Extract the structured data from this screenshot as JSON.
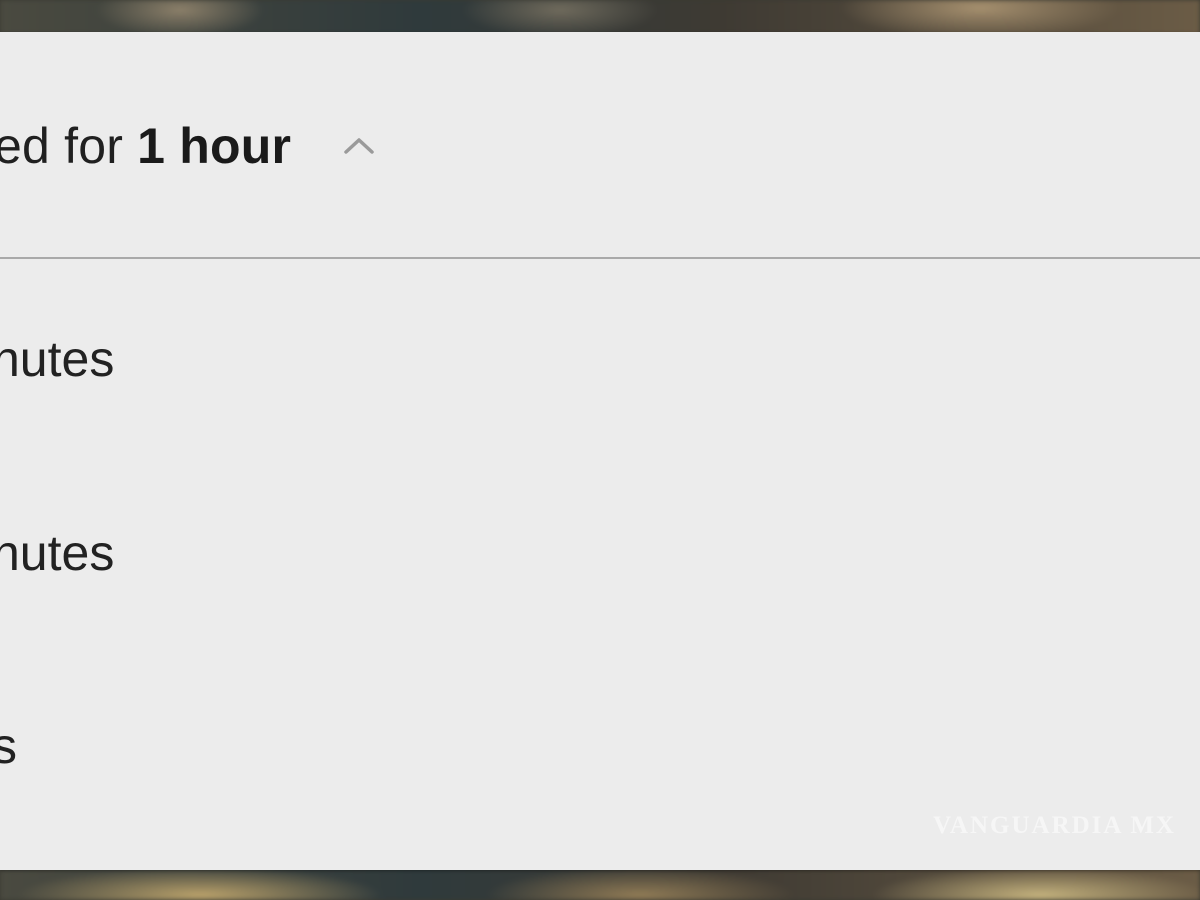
{
  "sheet": {
    "header": {
      "prefix": "ed for ",
      "duration": "1 hour",
      "chevron_icon": "chevron-up-icon"
    },
    "options": [
      {
        "label": "nutes"
      },
      {
        "label": "nutes"
      },
      {
        "label": "s"
      }
    ]
  },
  "watermark": "VANGUARDIA MX",
  "colors": {
    "sheet_background": "#ececec",
    "text": "#202020",
    "divider": "#a9a9a9",
    "chevron": "#9a9a9a"
  }
}
